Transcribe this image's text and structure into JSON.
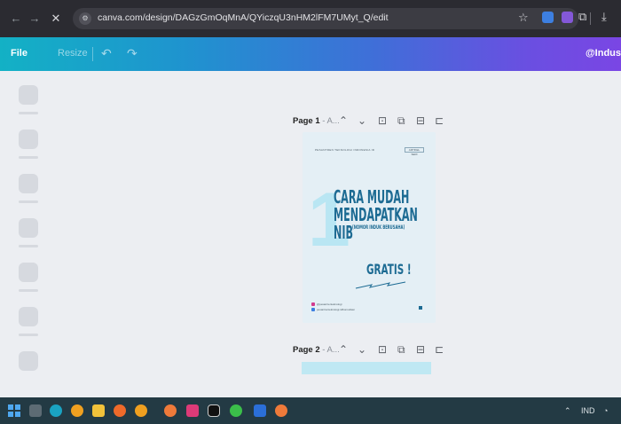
{
  "browser": {
    "url": "canva.com/design/DAGzGmOqMnA/QYiczqU3nHM2lFM7UMyt_Q/edit",
    "back_icon": "arrow-left-icon",
    "forward_icon": "arrow-right-icon",
    "close_icon": "close-icon",
    "site_icon": "site-settings-icon",
    "bookmark_icon": "star-icon"
  },
  "toolbar": {
    "file_label": "File",
    "resize_label": "Resize",
    "user_label": "@Indus",
    "undo_icon": "undo-icon",
    "redo_icon": "redo-icon"
  },
  "pages": [
    {
      "label": "Page 1",
      "title_suffix": " - A..."
    },
    {
      "label": "Page 2",
      "title_suffix": " - A..."
    }
  ],
  "page_actions": [
    "chevron-up-icon",
    "chevron-down-icon",
    "lock-icon",
    "duplicate-icon",
    "trash-icon",
    "add-page-icon"
  ],
  "design": {
    "header_left": "PESANTREN TEKNOLOGI INDONESIA ID",
    "header_right": "ARTIKEL SERI",
    "big_number": "1",
    "title_line1": "CARA MUDAH",
    "title_line2": "MENDAPATKAN",
    "title_nib": "NIB",
    "title_sub": "(NOMOR INDUK BERUSAHA)",
    "gratis": "GRATIS !",
    "footer_ig": "@pesantrenteknologi",
    "footer_web": "pesantrenteknologi.id/konsultasi"
  },
  "colors": {
    "toolbar_start": "#13b1c5",
    "toolbar_end": "#7a46e4",
    "title": "#1d6b93",
    "accent_light": "#b9e6f3",
    "page_bg": "#e4eff5"
  },
  "taskbar": {
    "tray_language": "IND",
    "tray_chevron_icon": "chevron-up-icon",
    "tray_wifi_icon": "wifi-icon"
  }
}
